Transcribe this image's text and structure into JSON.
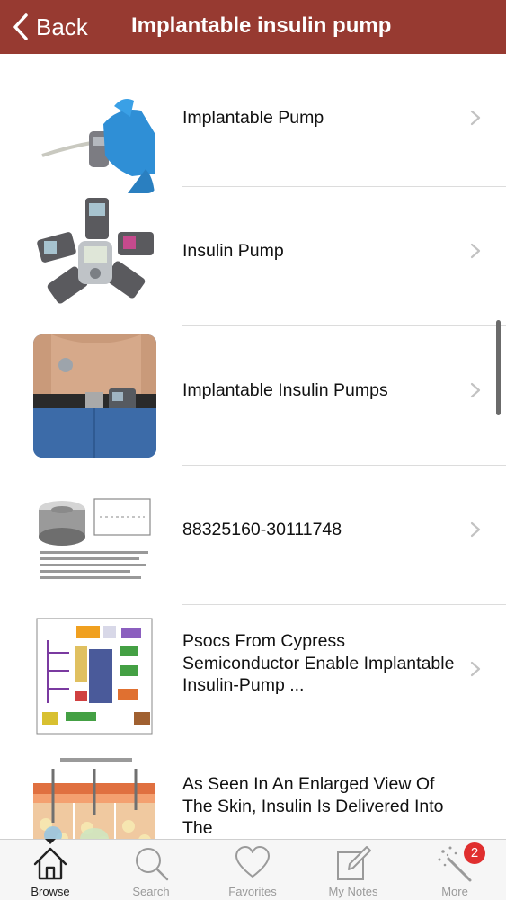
{
  "header": {
    "back_label": "Back",
    "title": "Implantable insulin pump",
    "background": "#973a31"
  },
  "list": {
    "items": [
      {
        "label": "Implantable Pump",
        "thumbnail": "blue-gloved-hand-holding-pump-image"
      },
      {
        "label": "Insulin Pump",
        "thumbnail": "circle-of-insulin-pumps-image"
      },
      {
        "label": "Implantable Insulin Pumps",
        "thumbnail": "patient-torso-with-pump-image"
      },
      {
        "label": "88325160-30111748",
        "thumbnail": "implanted-pump-diagram-image"
      },
      {
        "label": "Psocs From Cypress Semiconductor Enable Implantable Insulin-Pump ...",
        "thumbnail": "circuit-block-diagram-image"
      },
      {
        "label": "As Seen In An Enlarged View Of The Skin, Insulin Is Delivered Into The",
        "thumbnail": "skin-cross-section-image"
      }
    ]
  },
  "tabbar": {
    "tabs": [
      {
        "label": "Browse",
        "icon": "home-icon",
        "active": true
      },
      {
        "label": "Search",
        "icon": "search-icon",
        "active": false
      },
      {
        "label": "Favorites",
        "icon": "heart-icon",
        "active": false
      },
      {
        "label": "My Notes",
        "icon": "notes-icon",
        "active": false
      },
      {
        "label": "More",
        "icon": "magic-wand-icon",
        "active": false,
        "badge": "2"
      }
    ]
  }
}
